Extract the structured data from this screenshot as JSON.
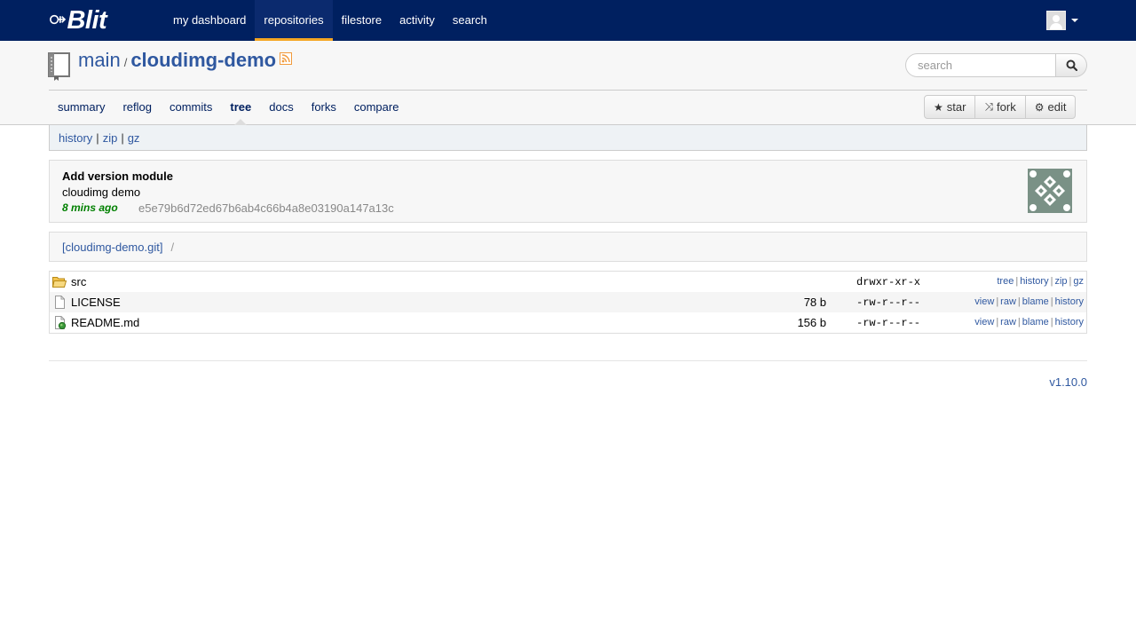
{
  "brand": {
    "glyph": "⚩",
    "name": "Blit"
  },
  "topnav": [
    {
      "label": "my dashboard",
      "active": false
    },
    {
      "label": "repositories",
      "active": true
    },
    {
      "label": "filestore",
      "active": false
    },
    {
      "label": "activity",
      "active": false
    },
    {
      "label": "search",
      "active": false
    }
  ],
  "repo": {
    "project": "main",
    "separator": "/",
    "name": "cloudimg-demo"
  },
  "search": {
    "placeholder": "search"
  },
  "tabs": [
    {
      "label": "summary"
    },
    {
      "label": "reflog"
    },
    {
      "label": "commits"
    },
    {
      "label": "tree",
      "active": true
    },
    {
      "label": "docs"
    },
    {
      "label": "forks"
    },
    {
      "label": "compare"
    }
  ],
  "buttons": {
    "star": {
      "icon": "★",
      "label": "star"
    },
    "fork": {
      "icon": "⤨",
      "label": "fork"
    },
    "edit": {
      "icon": "⚙",
      "label": "edit"
    }
  },
  "actions": {
    "history": "history",
    "zip": "zip",
    "gz": "gz",
    "pipe": "|"
  },
  "commit": {
    "title": "Add version module",
    "message": "cloudimg demo",
    "age": "8 mins ago",
    "sha": "e5e79b6d72ed67b6ab4c66b4a8e03190a147a13c"
  },
  "path": {
    "root": "[cloudimg-demo.git]",
    "slash": "/"
  },
  "files": [
    {
      "icon": "folder-icon",
      "name": "src",
      "size": "",
      "mode": "drwxr-xr-x",
      "links": [
        "tree",
        "history",
        "zip",
        "gz"
      ]
    },
    {
      "icon": "file-icon",
      "name": "LICENSE",
      "size": "78 b",
      "mode": "-rw-r--r--",
      "links": [
        "view",
        "raw",
        "blame",
        "history"
      ]
    },
    {
      "icon": "markdown-file-icon",
      "name": "README.md",
      "size": "156 b",
      "mode": "-rw-r--r--",
      "links": [
        "view",
        "raw",
        "blame",
        "history"
      ]
    }
  ],
  "footer": {
    "version": "v1.10.0"
  },
  "colors": {
    "navbar": "#002060",
    "accent": "#f5a623",
    "link": "#2F58A0",
    "commit_age": "#008000"
  }
}
